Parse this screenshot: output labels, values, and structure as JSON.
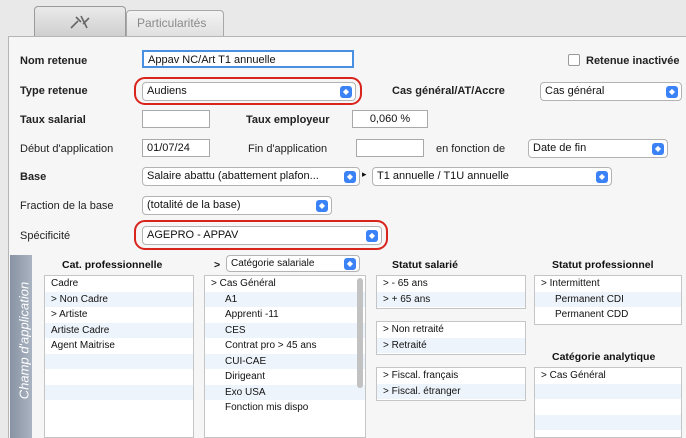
{
  "tabs": [
    {
      "label": "",
      "icon": "tool-icon"
    },
    {
      "label": "Particularités"
    }
  ],
  "form": {
    "nom_retenue": {
      "label": "Nom retenue",
      "value": "Appav  NC/Art T1 annuelle"
    },
    "retenue_inactivee": {
      "label": "Retenue inactivée",
      "checked": false
    },
    "type_retenue": {
      "label": "Type retenue",
      "value": "Audiens"
    },
    "cas_general": {
      "label": "Cas général/AT/Accre",
      "value": "Cas général"
    },
    "taux_salarial": {
      "label": "Taux salarial",
      "value": ""
    },
    "taux_employeur": {
      "label": "Taux employeur",
      "value": "0,060 %"
    },
    "debut_application": {
      "label": "Début d'application",
      "value": "01/07/24"
    },
    "fin_application": {
      "label": "Fin d'application",
      "value": ""
    },
    "en_fonction_de": {
      "label": "en fonction de",
      "value": "Date de fin"
    },
    "base": {
      "label": "Base",
      "value": "Salaire abattu (abattement plafon...",
      "sub_value": "T1 annuelle / T1U annuelle"
    },
    "fraction_base": {
      "label": "Fraction de la base",
      "value": "(totalité de la base)"
    },
    "specificite": {
      "label": "Spécificité",
      "value": "AGEPRO - APPAV"
    }
  },
  "champ_application": {
    "side_label": "Champ d'application",
    "cat_professionnelle": {
      "header": "Cat. professionnelle",
      "items": [
        "Cadre",
        "> Non Cadre",
        "> Artiste",
        "Artiste Cadre",
        "Agent Maitrise",
        "",
        "",
        "",
        ""
      ]
    },
    "categorie_salariale": {
      "header_prefix": ">",
      "select_value": "Catégorie salariale",
      "items": [
        "> Cas Général",
        "A1",
        "Apprenti -11",
        "CES",
        "Contrat pro > 45 ans",
        "CUI-CAE",
        "Dirigeant",
        "Exo USA",
        "Fonction mis dispo"
      ]
    },
    "statut_salarie": {
      "header": "Statut salarié",
      "group1": [
        ">  - 65 ans",
        ">  + 65 ans"
      ],
      "group2": [
        "> Non retraité",
        "> Retraité"
      ],
      "group3": [
        "> Fiscal. français",
        "> Fiscal. étranger"
      ]
    },
    "statut_professionnel": {
      "header": "Statut professionnel",
      "items": [
        "> Intermittent",
        "Permanent CDI",
        "Permanent CDD"
      ]
    },
    "categorie_analytique": {
      "header": "Catégorie analytique",
      "items": [
        "> Cas Général",
        "",
        "",
        "",
        ""
      ]
    }
  },
  "colors": {
    "accent": "#3b82f6",
    "highlight_ring": "#d9231d",
    "side_bar": "#98a2b2"
  }
}
